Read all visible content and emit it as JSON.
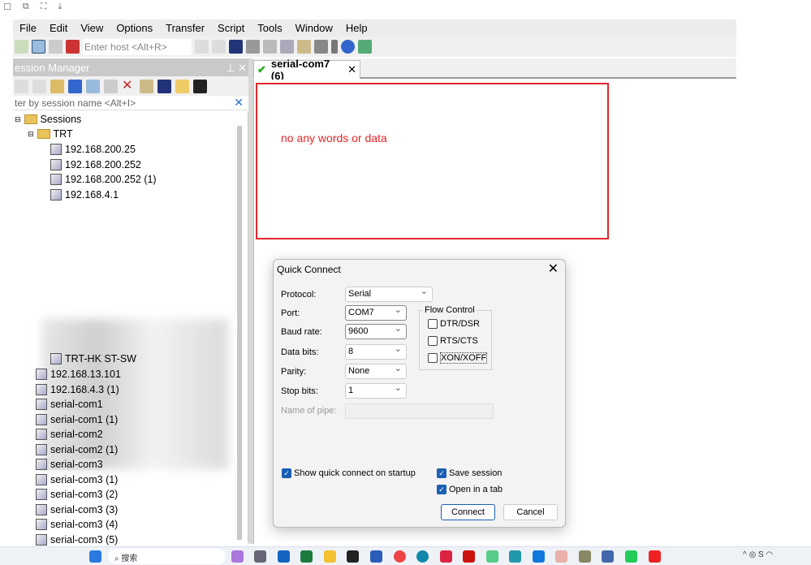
{
  "menu": [
    "File",
    "Edit",
    "View",
    "Options",
    "Transfer",
    "Script",
    "Tools",
    "Window",
    "Help"
  ],
  "toolbar": {
    "host_placeholder": "Enter host <Alt+R>"
  },
  "session_manager": {
    "title": "ession Manager",
    "filter_placeholder": "ter by session name <Alt+I>",
    "root": "Sessions",
    "folder": "TRT",
    "trt_items": [
      "192.168.200.25",
      "192.168.200.252",
      "192.168.200.252 (1)",
      "192.168.4.1"
    ],
    "trt_last": "TRT-HK ST-SW",
    "items": [
      "192.168.13.101",
      "192.168.4.3 (1)",
      "serial-com1",
      "serial-com1 (1)",
      "serial-com2",
      "serial-com2 (1)",
      "serial-com3",
      "serial-com3 (1)",
      "serial-com3 (2)",
      "serial-com3 (3)",
      "serial-com3 (4)",
      "serial-com3 (5)"
    ],
    "selected": "serial-com3"
  },
  "tab": {
    "label": "serial-com7 (6)",
    "status": "connected"
  },
  "annotation": "no any words or data",
  "dialog": {
    "title": "Quick Connect",
    "protocol_label": "Protocol:",
    "protocol": "Serial",
    "port_label": "Port:",
    "port": "COM7",
    "baud_label": "Baud rate:",
    "baud": "9600",
    "databits_label": "Data bits:",
    "databits": "8",
    "parity_label": "Parity:",
    "parity": "None",
    "stopbits_label": "Stop bits:",
    "stopbits": "1",
    "pipe_label": "Name of pipe:",
    "flow_title": "Flow Control",
    "dtr": "DTR/DSR",
    "rts": "RTS/CTS",
    "xon": "XON/XOFF",
    "show_startup": "Show quick connect on startup",
    "save_session": "Save session",
    "open_tab": "Open in a tab",
    "connect": "Connect",
    "cancel": "Cancel"
  },
  "taskbar": {
    "search": "搜索"
  },
  "colors": {
    "annotation": "#e3262b",
    "accent": "#1a5fb4"
  }
}
